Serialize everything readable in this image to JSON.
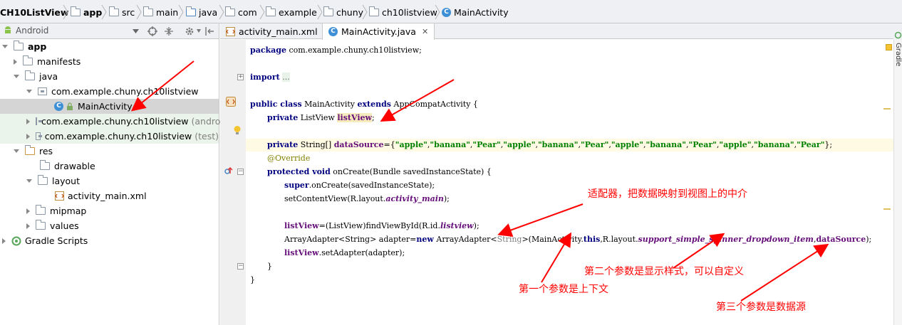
{
  "breadcrumb": [
    "CH10ListView",
    "app",
    "src",
    "main",
    "java",
    "com",
    "example",
    "chuny",
    "ch10listview",
    "MainActivity"
  ],
  "project_toolbar": {
    "view_label": "Android"
  },
  "tree": [
    {
      "label": "app",
      "bold": true
    },
    {
      "label": "manifests"
    },
    {
      "label": "java"
    },
    {
      "label": "com.example.chuny.ch10listview"
    },
    {
      "label": "MainActivity"
    },
    {
      "label": "com.example.chuny.ch10listview",
      "suffix": "(androidTest)"
    },
    {
      "label": "com.example.chuny.ch10listview",
      "suffix": "(test)"
    },
    {
      "label": "res"
    },
    {
      "label": "drawable"
    },
    {
      "label": "layout"
    },
    {
      "label": "activity_main.xml"
    },
    {
      "label": "mipmap"
    },
    {
      "label": "values"
    },
    {
      "label": "Gradle Scripts"
    }
  ],
  "tabs": [
    {
      "label": "activity_main.xml",
      "active": false
    },
    {
      "label": "MainActivity.java",
      "active": true
    }
  ],
  "right_tool": "Gradle",
  "code": {
    "package": "package com.example.chuny.ch10listview;",
    "import_kw": "import",
    "import_fold": "...",
    "cls_kw": "public class",
    "cls_name": " MainActivity ",
    "extends_kw": "extends",
    "cls_super": " AppCompatActivity {",
    "f1_kw": "private",
    "f1_type": " ListView ",
    "f1_name": "listView",
    "f1_end": ";",
    "f2_kw": "private",
    "f2_type": " String[] ",
    "f2_name": "dataSource",
    "f2_eq": "={",
    "f2_items": [
      "\"apple\"",
      "\"banana\"",
      "\"Pear\"",
      "\"apple\"",
      "\"banana\"",
      "\"Pear\"",
      "\"apple\"",
      "\"banana\"",
      "\"Pear\"",
      "\"apple\"",
      "\"banana\"",
      "\"Pear\""
    ],
    "f2_end": "};",
    "override": "@Override",
    "m_kw": "protected void",
    "m_sig": " onCreate(Bundle savedInstanceState) {",
    "super_kw": "super",
    "super_rest": ".onCreate(savedInstanceState);",
    "scv_a": "setContentView(R.layout.",
    "scv_b": "activity_main",
    "scv_c": ");",
    "fv_a": "listView",
    "fv_b": "=(ListView)findViewById(R.id.",
    "fv_c": "listview",
    "fv_d": ");",
    "aa_a": "ArrayAdapter<String> adapter=",
    "aa_new": "new",
    "aa_b": " ArrayAdapter<",
    "aa_gen": "String",
    "aa_c": ">(MainActivity.",
    "aa_this": "this",
    "aa_d": ",R.layout.",
    "aa_res": "support_simple_spinner_dropdown_item",
    "aa_e": ",",
    "aa_ds": "dataSource",
    "aa_f": ");",
    "sa_a": "listView",
    "sa_b": ".setAdapter(adapter);",
    "close1": "}",
    "close2": "}"
  },
  "annotations": {
    "adapter": "适配器，把数据映射到视图上的中介",
    "param2": "第二个参数是显示样式，可以自定义",
    "param1": "第一个参数是上下文",
    "param3": "第三个参数是数据源"
  },
  "colors": {
    "annotation": "#ff0000",
    "keyword": "#000080",
    "string": "#008000",
    "field": "#660e7a"
  }
}
